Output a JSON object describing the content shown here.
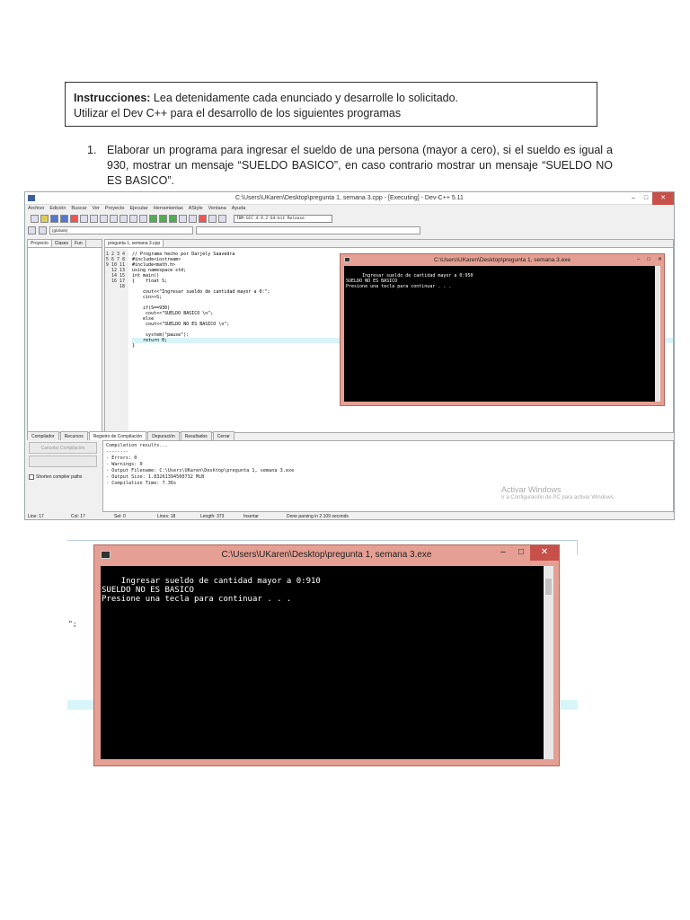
{
  "instructions": {
    "label": "Instrucciones:",
    "line1_rest": " Lea detenidamente cada enunciado y desarrolle lo solicitado.",
    "line2": "Utilizar el Dev C++ para el desarrollo de los siguientes programas"
  },
  "item1": {
    "number": "1.",
    "text": "Elaborar un programa para ingresar el sueldo de una persona (mayor a cero), si el sueldo es igual a 930, mostrar un mensaje “SUELDO BASICO”, en caso contrario mostrar un mensaje “SUELDO NO ES BASICO”."
  },
  "ide": {
    "title": "C:\\Users\\UKaren\\Desktop\\pregunta 1, semana 3.cpp - [Executing] - Dev-C++ 5.11",
    "menu": [
      "Archivo",
      "Edición",
      "Buscar",
      "Ver",
      "Proyecto",
      "Ejecutar",
      "Herramientas",
      "AStyle",
      "Ventana",
      "Ayuda"
    ],
    "compiler": "TDM-GCC 4.9.2 64-bit Release",
    "scope": "(globals)",
    "left_tabs": [
      "Proyecto",
      "Clases",
      "Fun"
    ],
    "file_tab": "pregunta 1, semana 3.cpp",
    "line_numbers": "1\n2\n3\n4\n5\n6\n7\n8\n9\n10\n11\n12\n13\n14\n15\n16\n17\n18",
    "code": "// Programa hecho por Darjely Saavedra\n#include<iostream>\n#include<math.h>\nusing namespace std;\nint main()\n{    float S;\n\n    cout<<\"Ingresar sueldo de cantidad mayor a 0:\";\n    cin>>S;\n\n    if(S==930)\n     cout<<\"SUELDO BASICO \\n\";\n    else\n     cout<<\"SUELDO NO ES BASICO \\n\";\n\n     system(\"pause\");\n    return 0;\n}",
    "bottom_tabs": [
      "Compilador",
      "Recursos",
      "Registro de Compilación",
      "Depuración",
      "Resultados",
      "Cerrar"
    ],
    "abort_button": "Cancelar Compilación",
    "shorten_label": "Shorten compiler paths",
    "compile_log": "Compilation results...\n--------\n- Errors: 0\n- Warnings: 0\n- Output Filename: C:\\Users\\UKaren\\Desktop\\pregunta 1, semana 3.exe\n- Output Size: 1.83261394500732 MiB\n- Compilation Time: 7.36s",
    "watermark_title": "Activar Windows",
    "watermark_sub": "Ir a Configuración de PC para activar Windows.",
    "status": {
      "line": "Line:   17",
      "col": "Col:   17",
      "sel": "Sel:   0",
      "lines": "Lines:   18",
      "length": "Length:   373",
      "mode": "Insertar",
      "parse": "Done parsing in 2.109 seconds"
    }
  },
  "console": {
    "title": "C:\\Users\\UKaren\\Desktop\\pregunta 1, semana 3.exe",
    "output_small": "Ingresar sueldo de cantidad mayor a 0:950\nSUELDO NO ES BASICO\nPresione una tecla para continuar . . .",
    "output_large": "Ingresar sueldo de cantidad mayor a 0:910\nSUELDO NO ES BASICO\nPresione una tecla para continuar . . .",
    "stray_text": "\";"
  }
}
